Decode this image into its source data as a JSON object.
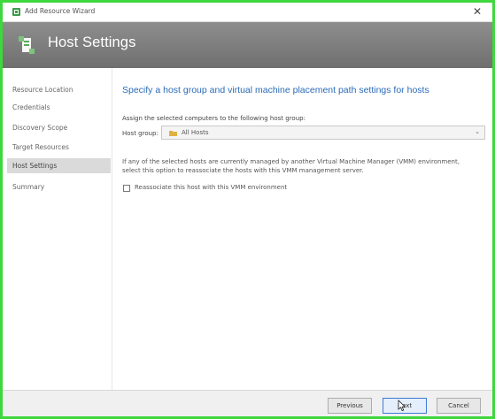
{
  "window": {
    "title": "Add Resource Wizard",
    "close_glyph": "✕"
  },
  "banner": {
    "title": "Host Settings"
  },
  "sidebar": {
    "items": [
      {
        "label": "Resource Location"
      },
      {
        "label": "Credentials"
      },
      {
        "label": "Discovery Scope"
      },
      {
        "label": "Target Resources"
      },
      {
        "label": "Host Settings"
      },
      {
        "label": "Summary"
      }
    ],
    "active_index": 4
  },
  "main": {
    "heading": "Specify a host group and virtual machine placement path settings for hosts",
    "assign_text": "Assign the selected computers to the following host group:",
    "host_group": {
      "label": "Host group:",
      "value": "All Hosts",
      "chevron": "⌄"
    },
    "info_text": "If any of the selected hosts are currently managed by another Virtual Machine Manager (VMM) environment, select this option to reassociate the hosts with this VMM management server.",
    "reassociate_checkbox": {
      "label": "Reassociate this host with this VMM environment",
      "checked": false
    }
  },
  "footer": {
    "previous_label": "Previous",
    "next_label": "Next",
    "cancel_label": "Cancel"
  },
  "colors": {
    "frame_border": "#3ed73e",
    "heading_blue": "#2a6bb8",
    "banner_gray": "#7a7a7a",
    "active_nav_bg": "#dadada"
  }
}
